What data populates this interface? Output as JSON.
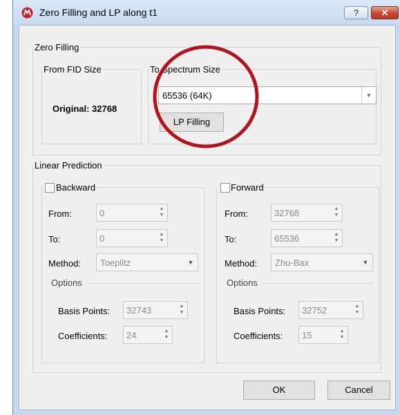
{
  "window": {
    "title": "Zero Filling and LP along t1",
    "help_label": "?",
    "close_label": "✕"
  },
  "zero_filling": {
    "legend": "Zero Filling",
    "from_fid": {
      "legend": "From FID Size",
      "value": "Original: 32768"
    },
    "to_spectrum": {
      "legend": "To Spectrum Size",
      "selected": "65536 (64K)",
      "lp_button": "LP Filling"
    }
  },
  "linear_prediction": {
    "legend": "Linear Prediction",
    "backward": {
      "label": "Backward",
      "checked": false,
      "from_label": "From:",
      "from_value": "0",
      "to_label": "To:",
      "to_value": "0",
      "method_label": "Method:",
      "method_value": "Toeplitz",
      "options_label": "Options",
      "basis_label": "Basis Points:",
      "basis_value": "32743",
      "coeff_label": "Coefficients:",
      "coeff_value": "24"
    },
    "forward": {
      "label": "Forward",
      "checked": false,
      "from_label": "From:",
      "from_value": "32768",
      "to_label": "To:",
      "to_value": "65536",
      "method_label": "Method:",
      "method_value": "Zhu-Bax",
      "options_label": "Options",
      "basis_label": "Basis Points:",
      "basis_value": "32752",
      "coeff_label": "Coefficients:",
      "coeff_value": "15"
    }
  },
  "buttons": {
    "ok": "OK",
    "cancel": "Cancel"
  },
  "colors": {
    "annotation_circle": "#b3141b",
    "titlebar": "#c7dbf0",
    "close_button": "#c9452f"
  },
  "icons": [
    "app-logo-icon",
    "help-icon",
    "close-icon",
    "dropdown-arrow-icon",
    "spin-arrows-icon"
  ]
}
